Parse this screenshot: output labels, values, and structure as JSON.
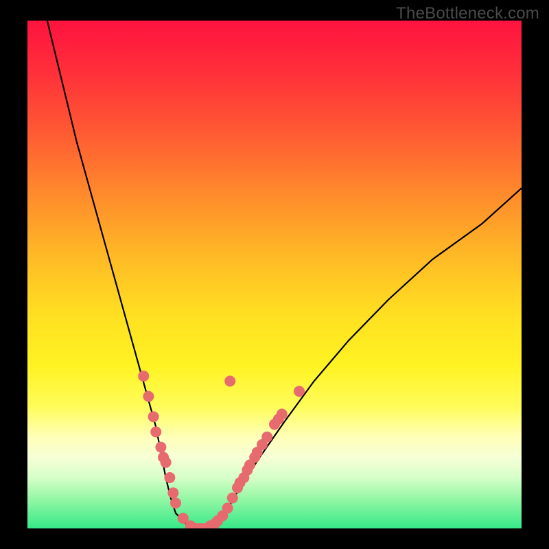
{
  "watermark": "TheBottleneck.com",
  "chart_data": {
    "type": "line",
    "title": "",
    "xlabel": "",
    "ylabel": "",
    "xlim": [
      0,
      100
    ],
    "ylim": [
      0,
      100
    ],
    "series": [
      {
        "name": "bottleneck-curve",
        "x": [
          4,
          6,
          8,
          10,
          12,
          14,
          16,
          18,
          20,
          22,
          24,
          26,
          27,
          28,
          29,
          30,
          32,
          34,
          36,
          38,
          40,
          43,
          47,
          52,
          58,
          65,
          73,
          82,
          92,
          100
        ],
        "values": [
          100,
          92,
          84,
          76,
          69,
          62,
          55,
          48,
          41,
          34,
          27,
          20,
          15,
          10,
          6,
          3,
          1,
          0,
          0,
          1,
          3,
          8,
          14,
          21,
          29,
          37,
          45,
          53,
          60,
          67
        ]
      }
    ],
    "markers": {
      "name": "highlighted-points",
      "color": "#e76a6f",
      "points": [
        {
          "x": 23.5,
          "y": 30
        },
        {
          "x": 24.5,
          "y": 26
        },
        {
          "x": 25.5,
          "y": 22
        },
        {
          "x": 26.0,
          "y": 19
        },
        {
          "x": 27.0,
          "y": 16
        },
        {
          "x": 27.5,
          "y": 14
        },
        {
          "x": 28.0,
          "y": 13
        },
        {
          "x": 28.8,
          "y": 10
        },
        {
          "x": 29.5,
          "y": 7
        },
        {
          "x": 30.0,
          "y": 5
        },
        {
          "x": 31.5,
          "y": 2
        },
        {
          "x": 33.0,
          "y": 0.5
        },
        {
          "x": 34.0,
          "y": 0
        },
        {
          "x": 35.0,
          "y": 0
        },
        {
          "x": 36.0,
          "y": 0
        },
        {
          "x": 37.0,
          "y": 0.5
        },
        {
          "x": 38.0,
          "y": 1
        },
        {
          "x": 38.5,
          "y": 1.5
        },
        {
          "x": 39.5,
          "y": 2.5
        },
        {
          "x": 40.5,
          "y": 4
        },
        {
          "x": 41.5,
          "y": 6
        },
        {
          "x": 42.5,
          "y": 8
        },
        {
          "x": 43.0,
          "y": 9
        },
        {
          "x": 43.8,
          "y": 10
        },
        {
          "x": 44.5,
          "y": 11.5
        },
        {
          "x": 45.0,
          "y": 12.5
        },
        {
          "x": 46.0,
          "y": 14
        },
        {
          "x": 46.5,
          "y": 15
        },
        {
          "x": 47.5,
          "y": 16.5
        },
        {
          "x": 48.5,
          "y": 18
        },
        {
          "x": 50.0,
          "y": 20.5
        },
        {
          "x": 50.8,
          "y": 21.5
        },
        {
          "x": 51.5,
          "y": 22.5
        },
        {
          "x": 55.0,
          "y": 27
        },
        {
          "x": 41.0,
          "y": 29
        }
      ]
    },
    "gradient_stops": [
      {
        "pos": 0,
        "color": "#ff133f"
      },
      {
        "pos": 22,
        "color": "#ff5a33"
      },
      {
        "pos": 46,
        "color": "#ffb826"
      },
      {
        "pos": 68,
        "color": "#fff323"
      },
      {
        "pos": 86,
        "color": "#f6ffd6"
      },
      {
        "pos": 100,
        "color": "#36e988"
      }
    ]
  }
}
